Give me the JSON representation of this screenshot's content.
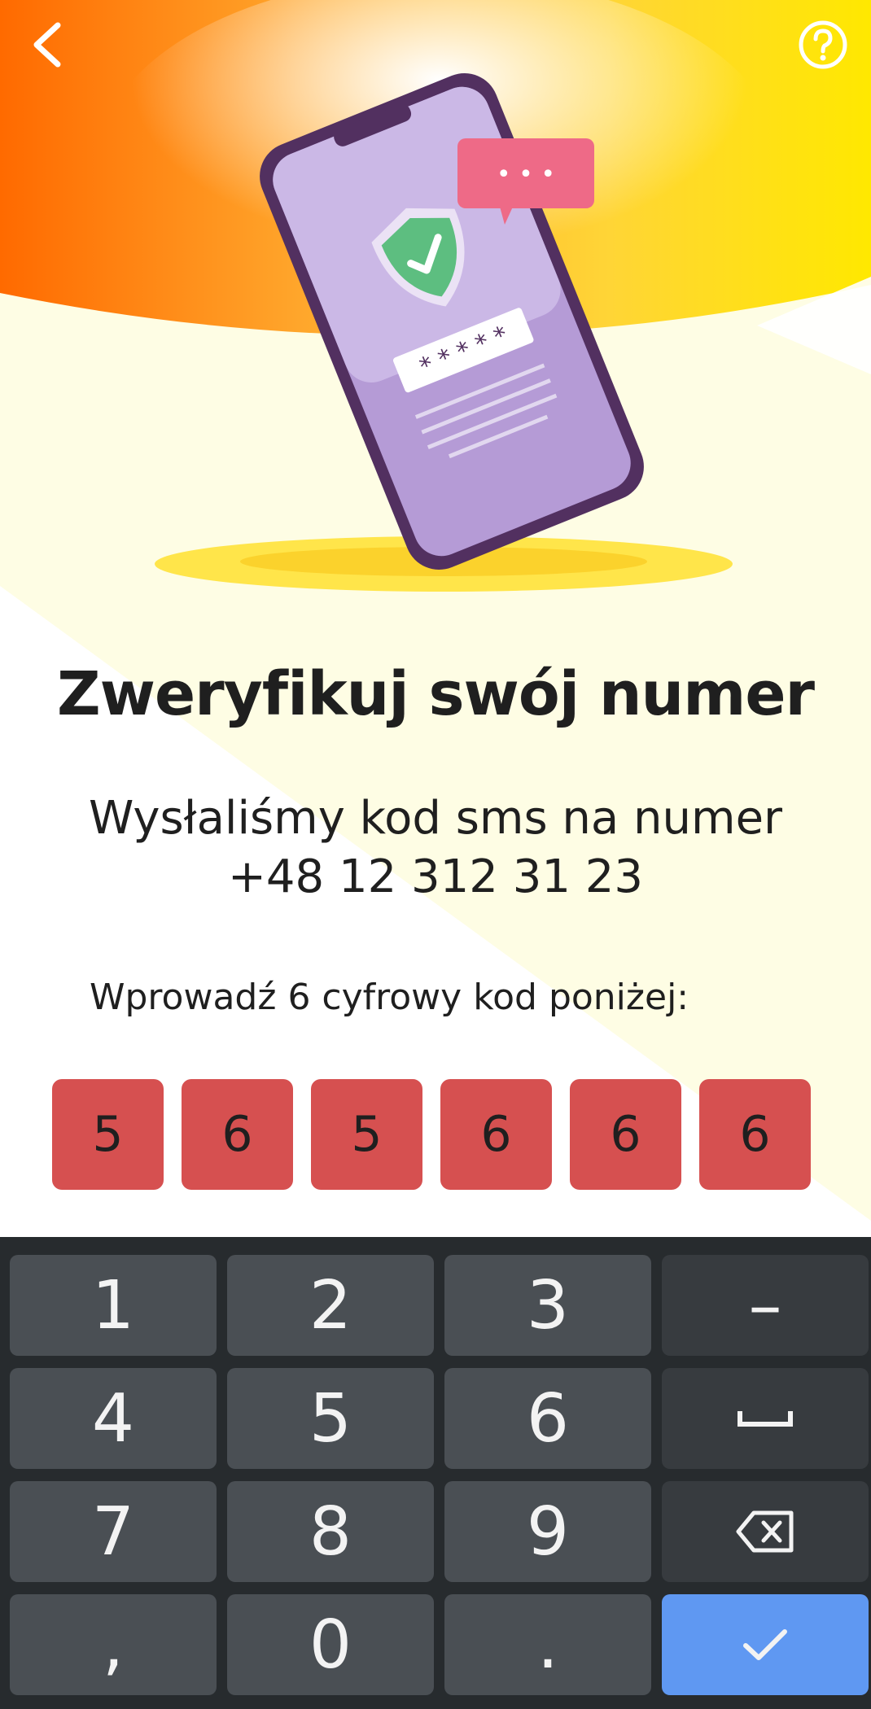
{
  "header": {
    "back_icon": "chevron-left-icon",
    "help_icon": "question-circle-icon"
  },
  "illustration": {
    "password_mask": "* * * * *",
    "bubble_dots": "• • •"
  },
  "title": "Zweryfikuj swój numer",
  "subtitle": {
    "line1": "Wysłaliśmy kod sms na numer",
    "line2": "+48 12 312 31 23"
  },
  "prompt": "Wprowadź 6 cyfrowy kod poniżej:",
  "code_digits": [
    "5",
    "6",
    "5",
    "6",
    "6",
    "6"
  ],
  "keyboard": {
    "keys": {
      "k1": "1",
      "k2": "2",
      "k3": "3",
      "dash": "–",
      "k4": "4",
      "k5": "5",
      "k6": "6",
      "k7": "7",
      "k8": "8",
      "k9": "9",
      "comma": ",",
      "k0": "0",
      "dot": "."
    },
    "icons": {
      "space": "space-bar-icon",
      "backspace": "backspace-icon",
      "enter": "checkmark-icon"
    }
  },
  "colors": {
    "code_box": "#d65050",
    "enter_key": "#5f98f2",
    "keyboard_bg": "#272b2e",
    "key_bg": "#4a4f54"
  }
}
